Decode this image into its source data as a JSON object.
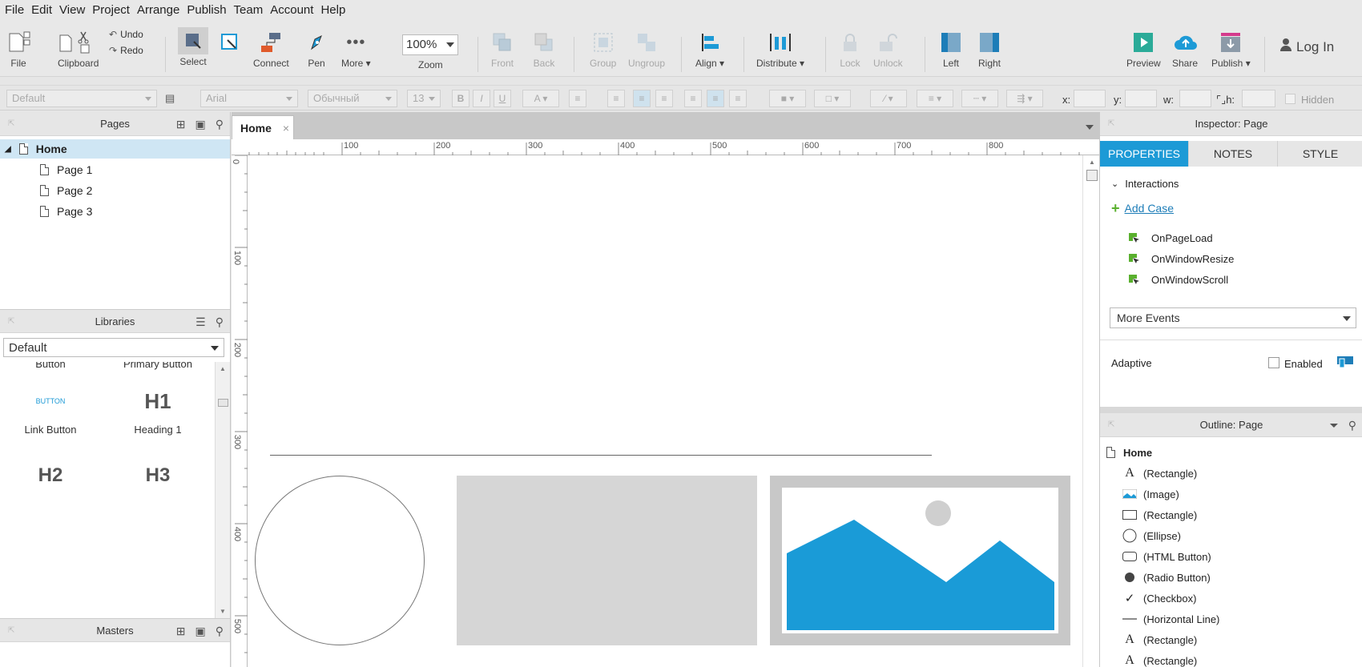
{
  "menu": [
    "File",
    "Edit",
    "View",
    "Project",
    "Arrange",
    "Publish",
    "Team",
    "Account",
    "Help"
  ],
  "toolbar": {
    "file": "File",
    "clipboard": "Clipboard",
    "undo": "Undo",
    "redo": "Redo",
    "select": "Select",
    "connect": "Connect",
    "pen": "Pen",
    "more": "More ▾",
    "zoom_value": "100%",
    "zoom": "Zoom",
    "front": "Front",
    "back": "Back",
    "group": "Group",
    "ungroup": "Ungroup",
    "align": "Align ▾",
    "distribute": "Distribute ▾",
    "lock": "Lock",
    "unlock": "Unlock",
    "left": "Left",
    "right": "Right",
    "preview": "Preview",
    "share": "Share",
    "publish": "Publish ▾",
    "login": "Log In"
  },
  "formatbar": {
    "style": "Default",
    "font": "Arial",
    "weight": "Обычный",
    "size": "13",
    "bold": "B",
    "italic": "I",
    "underline": "U",
    "x_label": "x:",
    "y_label": "y:",
    "w_label": "w:",
    "h_label": "h:",
    "hidden": "Hidden"
  },
  "pages_panel": {
    "title": "Pages",
    "pages": [
      "Home",
      "Page 1",
      "Page 2",
      "Page 3"
    ]
  },
  "libraries_panel": {
    "title": "Libraries",
    "selected": "Default",
    "items": {
      "button": "Button",
      "primary_button": "Primary Button",
      "link_button_preview": "BUTTON",
      "link_button": "Link Button",
      "h1": "H1",
      "heading1": "Heading 1",
      "h2": "H2",
      "h3": "H3"
    }
  },
  "masters_panel": {
    "title": "Masters"
  },
  "canvas": {
    "tab": "Home",
    "tab_close": "×",
    "hruler": [
      "100",
      "200",
      "300",
      "400",
      "500",
      "600",
      "700",
      "800"
    ],
    "vruler": [
      "0",
      "100",
      "200",
      "300",
      "400",
      "500"
    ],
    "colors": {
      "image_fill": "#1a9bd7",
      "placeholder": "#d6d6d6"
    }
  },
  "inspector": {
    "title": "Inspector: Page",
    "tabs": [
      "PROPERTIES",
      "NOTES",
      "STYLE"
    ],
    "interactions": "Interactions",
    "add_case": "Add Case",
    "events": [
      "OnPageLoad",
      "OnWindowResize",
      "OnWindowScroll"
    ],
    "more_events": "More Events",
    "adaptive": "Adaptive",
    "enabled": "Enabled"
  },
  "outline": {
    "title": "Outline: Page",
    "root": "Home",
    "items": [
      {
        "icon": "text-icon",
        "label": "(Rectangle)"
      },
      {
        "icon": "image-icon",
        "label": "(Image)"
      },
      {
        "icon": "rectangle-icon",
        "label": "(Rectangle)"
      },
      {
        "icon": "ellipse-icon",
        "label": "(Ellipse)"
      },
      {
        "icon": "html-button-icon",
        "label": "(HTML Button)"
      },
      {
        "icon": "radio-icon",
        "label": "(Radio Button)"
      },
      {
        "icon": "checkmark-icon",
        "label": "(Checkbox)"
      },
      {
        "icon": "line-icon",
        "label": "(Horizontal Line)"
      },
      {
        "icon": "text-icon",
        "label": "(Rectangle)"
      },
      {
        "icon": "text-icon",
        "label": "(Rectangle)"
      }
    ]
  },
  "accent": "#1d9ad6"
}
